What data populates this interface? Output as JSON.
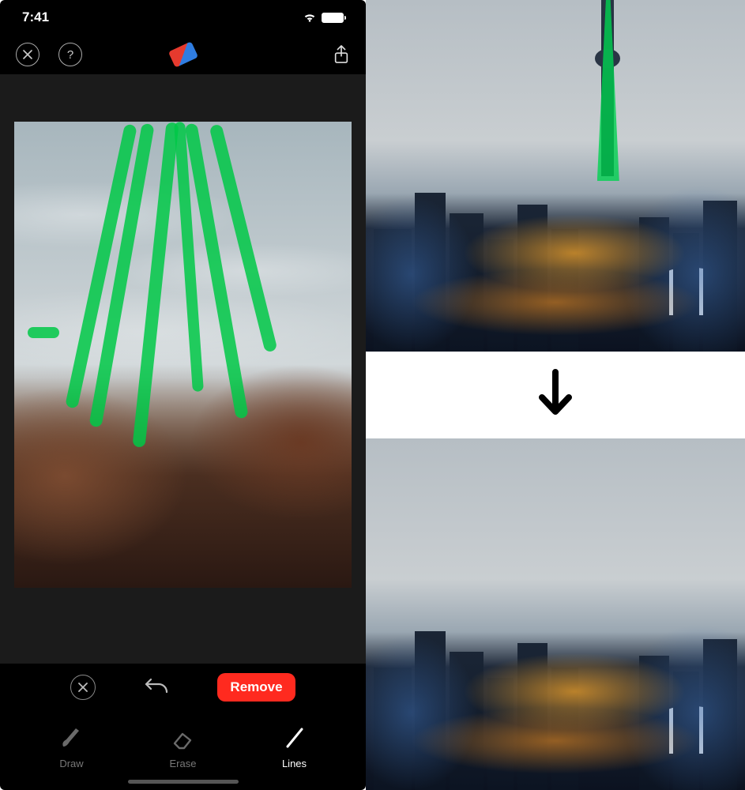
{
  "status": {
    "time": "7:41"
  },
  "actions": {
    "remove_label": "Remove"
  },
  "tools": [
    {
      "id": "draw",
      "label": "Draw",
      "active": false
    },
    {
      "id": "erase",
      "label": "Erase",
      "active": false
    },
    {
      "id": "lines",
      "label": "Lines",
      "active": true
    }
  ],
  "mark_color": "#00c84a",
  "accent_color": "#ff2a1f"
}
